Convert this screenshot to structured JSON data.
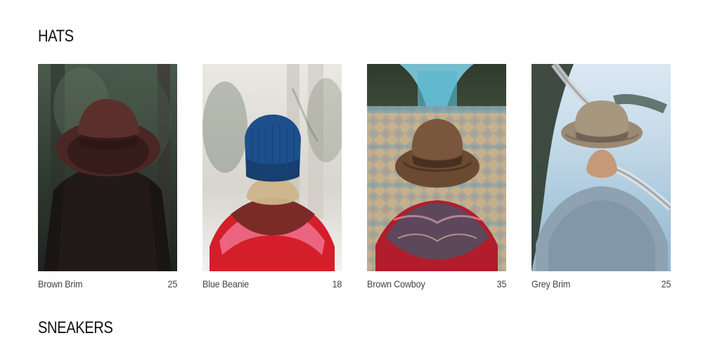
{
  "sections": [
    {
      "title": "HATS",
      "products": [
        {
          "name": "Brown Brim",
          "price": "25",
          "image_icon": "person-back-brown-brim-hat-forest-photo"
        },
        {
          "name": "Blue Beanie",
          "price": "18",
          "image_icon": "person-back-blue-beanie-snow-photo"
        },
        {
          "name": "Brown Cowboy",
          "price": "35",
          "image_icon": "person-back-brown-cowboy-hat-tiles-photo"
        },
        {
          "name": "Grey Brim",
          "price": "25",
          "image_icon": "person-back-grey-brim-hat-coast-road-photo"
        }
      ]
    },
    {
      "title": "SNEAKERS",
      "products": []
    }
  ],
  "colors": {
    "text": "#111111",
    "muted": "#444444",
    "background": "#ffffff"
  }
}
